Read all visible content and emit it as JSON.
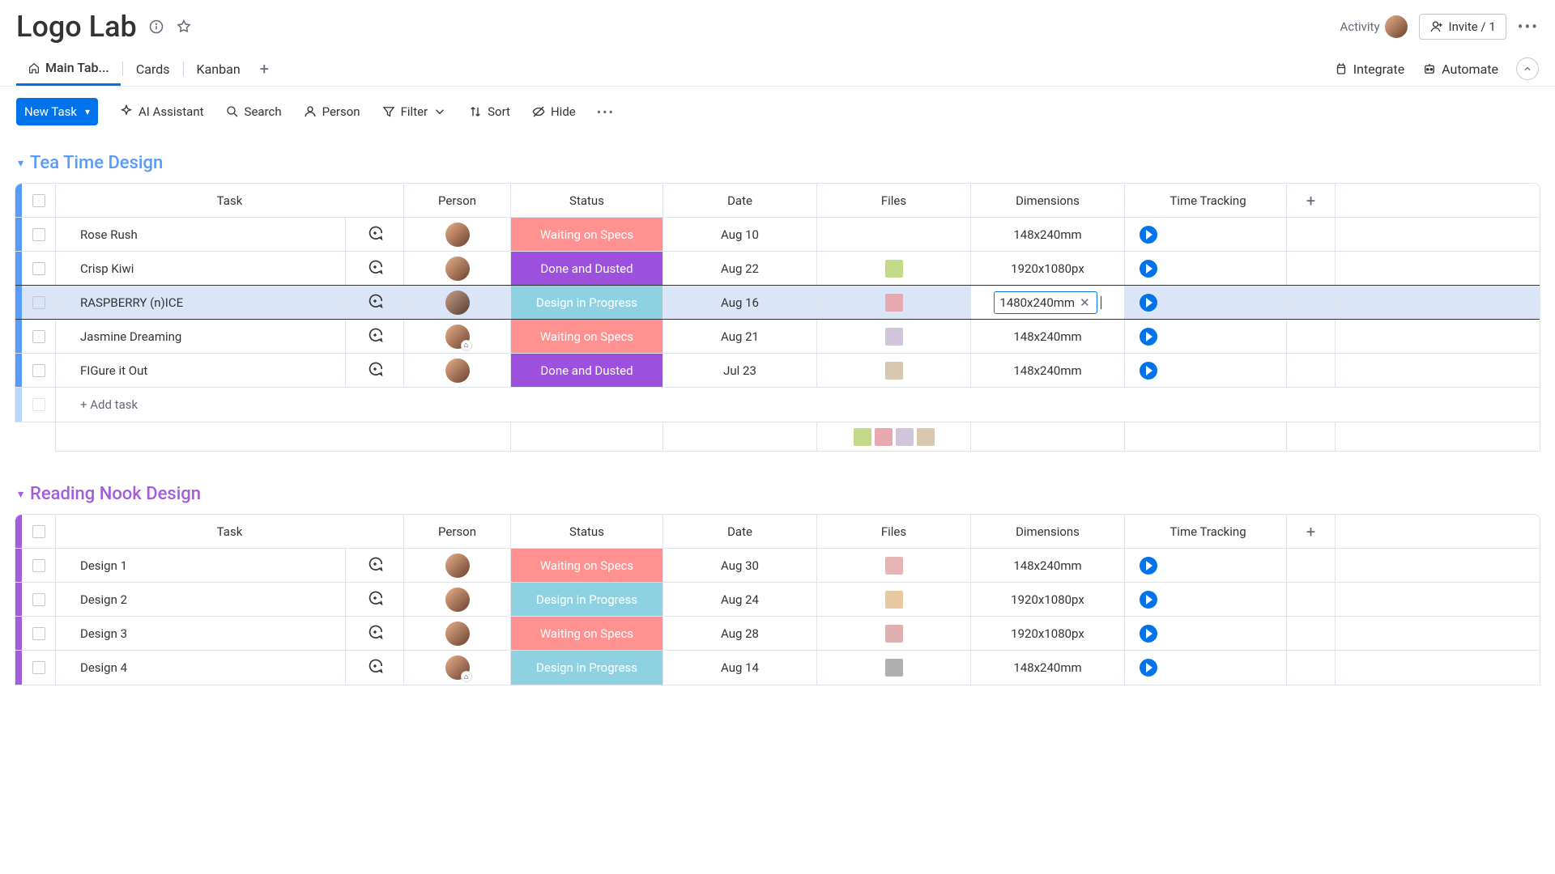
{
  "header": {
    "title": "Logo Lab",
    "activity_label": "Activity",
    "invite_label": "Invite / 1"
  },
  "tabs": {
    "items": [
      "Main Tab...",
      "Cards",
      "Kanban"
    ],
    "integrate": "Integrate",
    "automate": "Automate"
  },
  "toolbar": {
    "new_task": "New Task",
    "ai": "AI Assistant",
    "search": "Search",
    "person": "Person",
    "filter": "Filter",
    "sort": "Sort",
    "hide": "Hide"
  },
  "columns": {
    "task": "Task",
    "person": "Person",
    "status": "Status",
    "date": "Date",
    "files": "Files",
    "dimensions": "Dimensions",
    "time_tracking": "Time Tracking"
  },
  "status_labels": {
    "waiting": "Waiting on Specs",
    "done": "Done and Dusted",
    "progress": "Design in Progress"
  },
  "add_task_label": "+ Add task",
  "groups": [
    {
      "name": "Tea Time Design",
      "color": "blue",
      "rows": [
        {
          "task": "Rose Rush",
          "status": "waiting",
          "date": "Aug 10",
          "file": null,
          "dim": "148x240mm",
          "editing": false,
          "highlighted": false
        },
        {
          "task": "Crisp Kiwi",
          "status": "done",
          "date": "Aug 22",
          "file": "#c3d98a",
          "dim": "1920x1080px",
          "editing": false,
          "highlighted": false
        },
        {
          "task": "RASPBERRY (n)ICE",
          "status": "progress",
          "date": "Aug 16",
          "file": "#e7a8b0",
          "dim": "1480x240mm",
          "editing": true,
          "highlighted": true
        },
        {
          "task": "Jasmine Dreaming",
          "status": "waiting",
          "date": "Aug 21",
          "file": "#d0c5db",
          "dim": "148x240mm",
          "editing": false,
          "highlighted": false,
          "badge": true
        },
        {
          "task": "FIGure it Out",
          "status": "done",
          "date": "Jul 23",
          "file": "#d9c8b0",
          "dim": "148x240mm",
          "editing": false,
          "highlighted": false
        }
      ],
      "footer_files": [
        "#c3d98a",
        "#e7a8b0",
        "#d0c5db",
        "#d9c8b0"
      ]
    },
    {
      "name": "Reading Nook Design",
      "color": "purple",
      "rows": [
        {
          "task": "Design 1",
          "status": "waiting",
          "date": "Aug 30",
          "file": "#e7b5b5",
          "dim": "148x240mm",
          "editing": false,
          "highlighted": false
        },
        {
          "task": "Design 2",
          "status": "progress",
          "date": "Aug 24",
          "file": "#e8c8a0",
          "dim": "1920x1080px",
          "editing": false,
          "highlighted": false
        },
        {
          "task": "Design 3",
          "status": "waiting",
          "date": "Aug 28",
          "file": "#e0b0b0",
          "dim": "1920x1080px",
          "editing": false,
          "highlighted": false
        },
        {
          "task": "Design 4",
          "status": "progress",
          "date": "Aug 14",
          "file": "#b0b0b0",
          "dim": "148x240mm",
          "editing": false,
          "highlighted": false,
          "badge": true
        }
      ]
    }
  ]
}
